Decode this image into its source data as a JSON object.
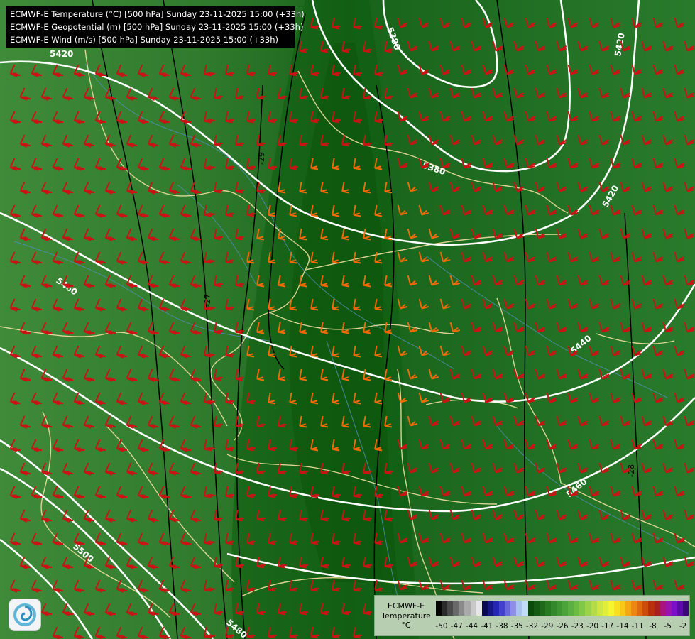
{
  "header": {
    "lines": [
      "ECMWF-E Temperature (°C) [500 hPa] Sunday 23-11-2025 15:00 (+33h)",
      "ECMWF-E Geopotential (m) [500 hPa] Sunday 23-11-2025 15:00 (+33h)",
      "ECMWF-E Wind (m/s) [500 hPa] Sunday 23-11-2025 15:00 (+33h)"
    ]
  },
  "map": {
    "geopotential_labels": [
      {
        "text": "5420"
      },
      {
        "text": "5380"
      },
      {
        "text": "5380"
      },
      {
        "text": "5420"
      },
      {
        "text": "5460"
      },
      {
        "text": "5440"
      },
      {
        "text": "5460"
      },
      {
        "text": "5500"
      },
      {
        "text": "5480"
      },
      {
        "text": "5420"
      }
    ],
    "temperature_labels": [
      {
        "text": "-29"
      },
      {
        "text": "-27"
      },
      {
        "text": "-28"
      }
    ],
    "colors": {
      "warm_green": "#3f8b3a",
      "cold_green": "#0e5c10",
      "isohypse": "#ffffff",
      "isotherm": "#000000",
      "borders": "#efe0a0",
      "rivers": "#4f8fb0",
      "barb_red": "#c81414",
      "barb_orange": "#f06a0a"
    }
  },
  "legend": {
    "title_lines": [
      "ECMWF-E",
      "Temperature",
      "°C"
    ],
    "ticks": [
      "-50",
      "-47",
      "-44",
      "-41",
      "-38",
      "-35",
      "-32",
      "-29",
      "-26",
      "-23",
      "-20",
      "-17",
      "-14",
      "-11",
      "-8",
      "-5",
      "-2"
    ],
    "colors": [
      "#050505",
      "#2a2a2a",
      "#4a4a4a",
      "#6a6a6a",
      "#8a8a8a",
      "#aaaaaa",
      "#c8c8c8",
      "#e6e6e6",
      "#0a0a50",
      "#161684",
      "#2525b4",
      "#4242cc",
      "#6868dc",
      "#8e8ee6",
      "#a8c4ee",
      "#c0dcf6",
      "#0a4a0a",
      "#145a14",
      "#1e6a1a",
      "#287a22",
      "#32882a",
      "#3e9632",
      "#4aa43a",
      "#5ab040",
      "#6cbc44",
      "#82c848",
      "#9ad24a",
      "#b4dc48",
      "#cce644",
      "#e2ee3c",
      "#f4f430",
      "#f8e020",
      "#f8c818",
      "#f4a814",
      "#ec8812",
      "#e06a10",
      "#cc4c0c",
      "#b8300a",
      "#a82020",
      "#a8147a",
      "#9812b4",
      "#7a10c8",
      "#5c0ca8",
      "#3c0878"
    ]
  }
}
